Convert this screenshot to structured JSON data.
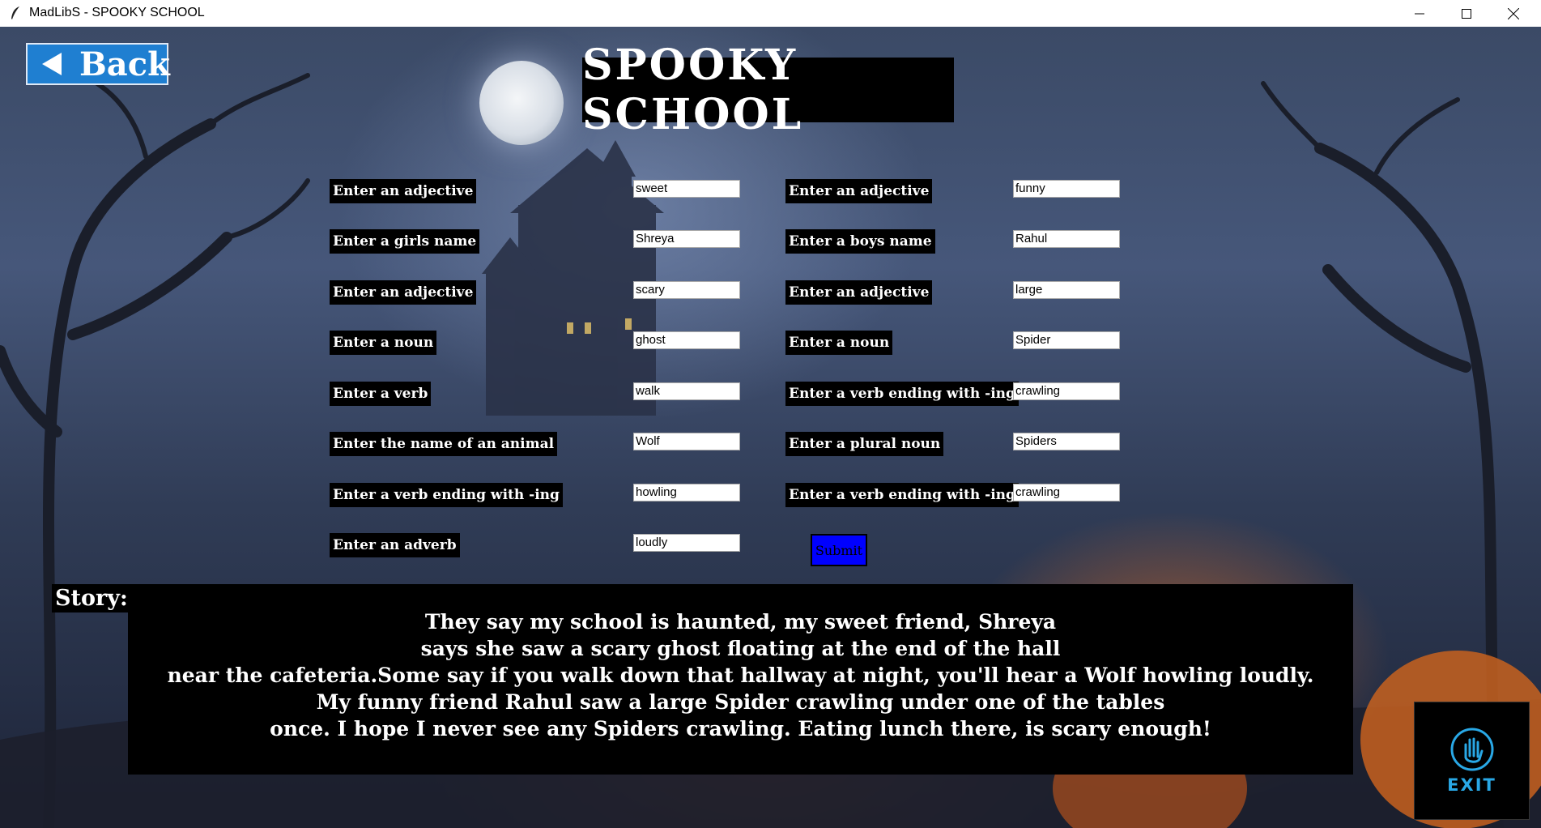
{
  "window": {
    "title": "MadLibS - SPOOKY SCHOOL"
  },
  "back_button": {
    "label": "Back"
  },
  "page_title": "SPOOKY SCHOOL",
  "form": {
    "left": [
      {
        "label": "Enter an adjective",
        "value": "sweet"
      },
      {
        "label": "Enter a girls name",
        "value": "Shreya"
      },
      {
        "label": "Enter an adjective",
        "value": "scary"
      },
      {
        "label": "Enter a noun",
        "value": "ghost"
      },
      {
        "label": "Enter a verb",
        "value": "walk"
      },
      {
        "label": "Enter the name of an animal",
        "value": "Wolf"
      },
      {
        "label": "Enter a verb ending with -ing",
        "value": "howling"
      },
      {
        "label": "Enter an adverb",
        "value": "loudly"
      }
    ],
    "right": [
      {
        "label": "Enter an adjective",
        "value": "funny"
      },
      {
        "label": "Enter a boys name",
        "value": "Rahul"
      },
      {
        "label": "Enter an adjective",
        "value": "large"
      },
      {
        "label": "Enter a noun",
        "value": "Spider"
      },
      {
        "label": "Enter a verb ending with -ing",
        "value": "crawling"
      },
      {
        "label": "Enter a plural noun",
        "value": "Spiders"
      },
      {
        "label": "Enter a verb ending with -ing",
        "value": "crawling"
      }
    ],
    "submit_label": "Submit"
  },
  "story": {
    "label": "Story:",
    "lines": [
      "They say my school is haunted, my sweet friend, Shreya",
      "says she saw a scary ghost floating at the end of the hall",
      "near the cafeteria.Some say if you walk down that hallway at night, you'll hear a Wolf howling loudly.",
      "My funny friend Rahul saw a large Spider crawling under one of the tables",
      "once. I hope I never see any Spiders crawling. Eating lunch there, is scary enough!"
    ]
  },
  "exit_button": {
    "label": "EXIT",
    "icon": "hand-icon"
  },
  "colors": {
    "back_button": "#1f7fd1",
    "submit_button": "#0000ff",
    "exit_text": "#29a8e6"
  }
}
